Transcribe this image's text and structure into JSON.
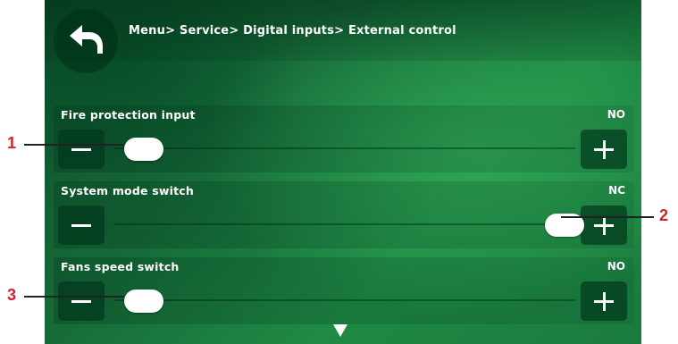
{
  "header": {
    "breadcrumb": "Menu> Service> Digital inputs> External control",
    "back_icon": "back-arrow-icon"
  },
  "rows": [
    {
      "label": "Fire protection input",
      "value": "NO",
      "position": "left"
    },
    {
      "label": "System mode switch",
      "value": "NC",
      "position": "right"
    },
    {
      "label": "Fans speed switch",
      "value": "NO",
      "position": "left"
    }
  ],
  "controls": {
    "minus_icon": "minus-icon",
    "plus_icon": "plus-icon",
    "scroll_icon": "scroll-down-arrow-icon"
  },
  "callouts": [
    "1",
    "2",
    "3"
  ],
  "colors": {
    "callout": "#d0202f",
    "knob": "#ffffff",
    "background": "#1a7a3d"
  }
}
